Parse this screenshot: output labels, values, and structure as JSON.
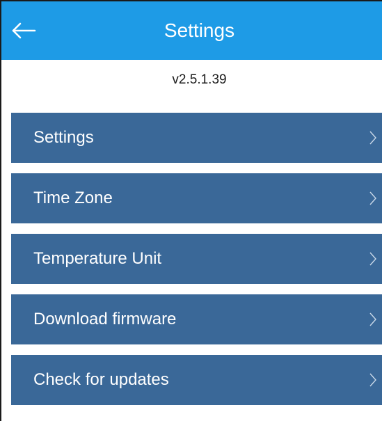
{
  "header": {
    "title": "Settings",
    "back_icon": "arrow-left-icon"
  },
  "version": "v2.5.1.39",
  "menu": {
    "items": [
      {
        "label": "Settings",
        "icon": "chevron-right-icon"
      },
      {
        "label": "Time Zone",
        "icon": "chevron-right-icon"
      },
      {
        "label": "Temperature Unit",
        "icon": "chevron-right-icon"
      },
      {
        "label": "Download firmware",
        "icon": "chevron-right-icon"
      },
      {
        "label": "Check for updates",
        "icon": "chevron-right-icon"
      }
    ]
  },
  "colors": {
    "app_bar": "#1e9be6",
    "menu_item": "#3a6898",
    "text_light": "#ffffff",
    "text_dark": "#1a1a1a"
  }
}
